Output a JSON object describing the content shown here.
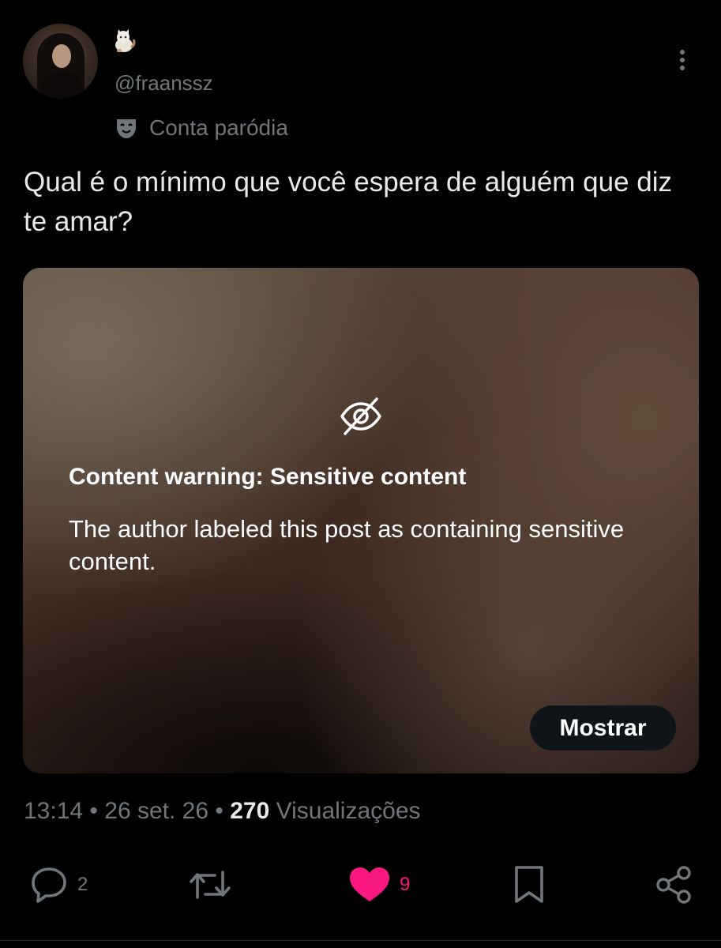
{
  "author": {
    "handle": "@fraanssz",
    "badge_icon": "cat-emoji-icon",
    "label": "Conta paródia",
    "label_icon": "theater-mask-icon"
  },
  "post": {
    "text": "Qual é o mínimo que você espera de alguém que diz te amar?"
  },
  "media_warning": {
    "icon": "eye-slash-icon",
    "title": "Content warning: Sensitive content",
    "body": "The author labeled this post as containing sensitive content.",
    "show_button": "Mostrar"
  },
  "meta": {
    "time": "13:14",
    "date": "26 set. 26",
    "views_count": "270",
    "views_label": "Visualizações"
  },
  "actions": {
    "replies": "2",
    "retweets": "",
    "likes": "9",
    "liked": true,
    "like_color": "#f91880"
  }
}
